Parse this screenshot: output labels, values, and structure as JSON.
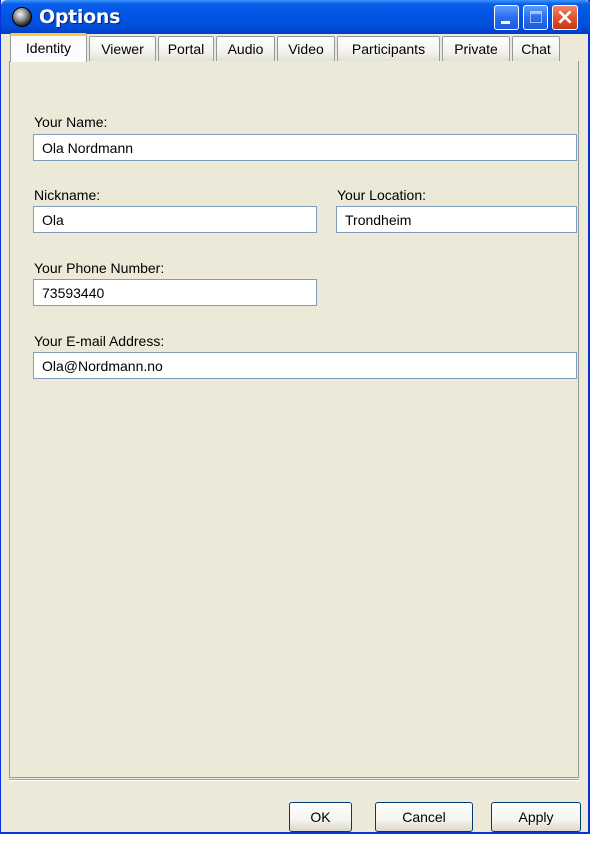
{
  "window": {
    "title": "Options"
  },
  "tabs": [
    {
      "label": "Identity",
      "active": true
    },
    {
      "label": "Viewer",
      "active": false
    },
    {
      "label": "Portal",
      "active": false
    },
    {
      "label": "Audio",
      "active": false
    },
    {
      "label": "Video",
      "active": false
    },
    {
      "label": "Participants",
      "active": false
    },
    {
      "label": "Private",
      "active": false
    },
    {
      "label": "Chat",
      "active": false
    }
  ],
  "form": {
    "name_label": "Your Name:",
    "name_value": "Ola Nordmann",
    "nickname_label": "Nickname:",
    "nickname_value": "Ola",
    "location_label": "Your Location:",
    "location_value": "Trondheim",
    "phone_label": "Your Phone Number:",
    "phone_value": "73593440",
    "email_label": "Your E-mail Address:",
    "email_value": "Ola@Nordmann.no"
  },
  "buttons": {
    "ok": "OK",
    "cancel": "Cancel",
    "apply": "Apply"
  },
  "colors": {
    "titlebar": "#0054e3",
    "active_tab_accent": "#ffc83c",
    "close_button": "#e2522e"
  }
}
